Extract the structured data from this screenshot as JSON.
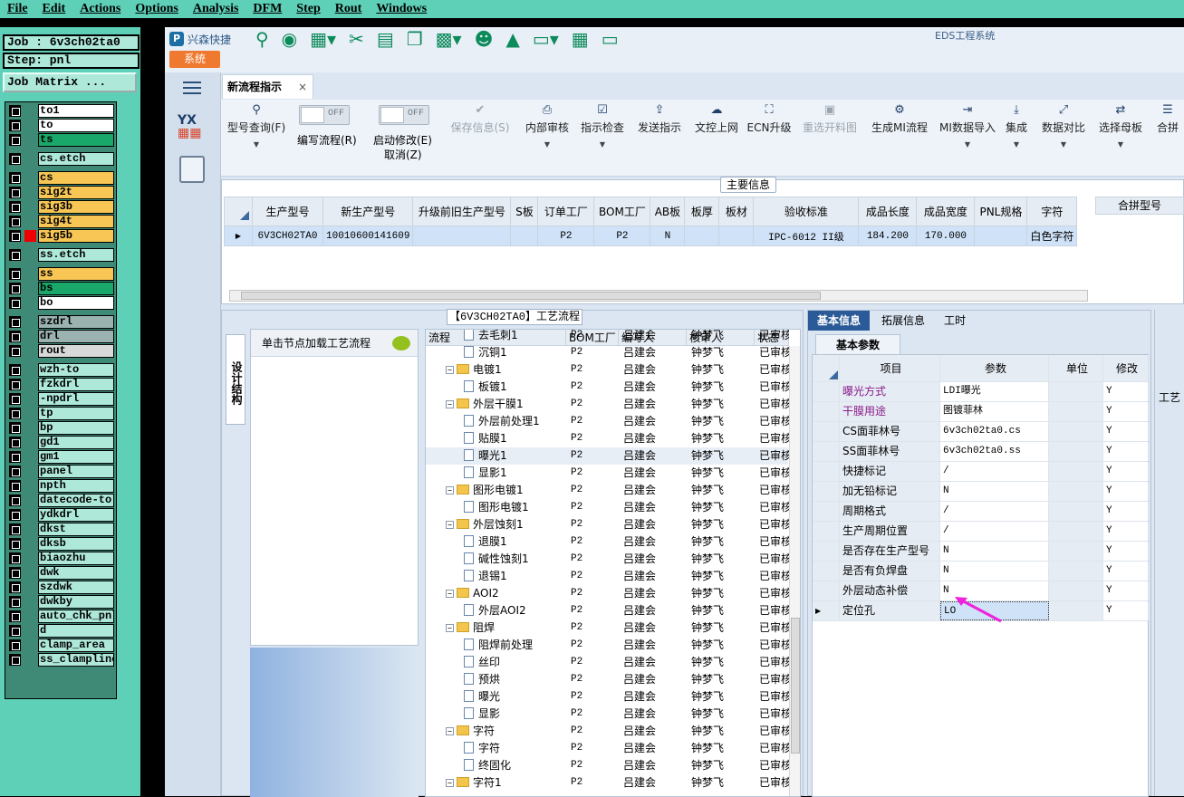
{
  "menu": [
    "File",
    "Edit",
    "Actions",
    "Options",
    "Analysis",
    "DFM",
    "Step",
    "Rout",
    "Windows"
  ],
  "job": {
    "job_label": "Job : 6v3ch02ta0",
    "step_label": "Step: pnl",
    "matrix_button": "Job Matrix ..."
  },
  "layers": [
    {
      "name": "to1",
      "bg": "#ffffff"
    },
    {
      "name": "to",
      "bg": "#ffffff"
    },
    {
      "name": "ts",
      "bg": "#1aa86a"
    },
    {
      "name": "cs.etch",
      "bg": "#aee8d9"
    },
    {
      "name": "cs",
      "bg": "#f7c655"
    },
    {
      "name": "sig2t",
      "bg": "#f7c655"
    },
    {
      "name": "sig3b",
      "bg": "#f7c655"
    },
    {
      "name": "sig4t",
      "bg": "#f7c655"
    },
    {
      "name": "sig5b",
      "bg": "#f7c655"
    },
    {
      "name": "ss.etch",
      "bg": "#aee8d9"
    },
    {
      "name": "ss",
      "bg": "#f7c655"
    },
    {
      "name": "bs",
      "bg": "#1aa86a"
    },
    {
      "name": "bo",
      "bg": "#ffffff"
    },
    {
      "name": "szdrl",
      "bg": "#9ab2b0"
    },
    {
      "name": "drl",
      "bg": "#9ab2b0"
    },
    {
      "name": "rout",
      "bg": "#d9d9d9"
    },
    {
      "name": "wzh-to",
      "bg": "#aee8d9"
    },
    {
      "name": "fzkdrl",
      "bg": "#aee8d9"
    },
    {
      "name": "-npdrl",
      "bg": "#aee8d9"
    },
    {
      "name": "tp",
      "bg": "#aee8d9"
    },
    {
      "name": "bp",
      "bg": "#aee8d9"
    },
    {
      "name": "gd1",
      "bg": "#aee8d9"
    },
    {
      "name": "gm1",
      "bg": "#aee8d9"
    },
    {
      "name": "panel",
      "bg": "#aee8d9"
    },
    {
      "name": "npth",
      "bg": "#aee8d9"
    },
    {
      "name": "datecode-to",
      "bg": "#aee8d9"
    },
    {
      "name": "ydkdrl",
      "bg": "#aee8d9"
    },
    {
      "name": "dkst",
      "bg": "#aee8d9"
    },
    {
      "name": "dksb",
      "bg": "#aee8d9"
    },
    {
      "name": "biaozhu",
      "bg": "#aee8d9"
    },
    {
      "name": "dwk",
      "bg": "#aee8d9"
    },
    {
      "name": "szdwk",
      "bg": "#aee8d9"
    },
    {
      "name": "dwkby",
      "bg": "#aee8d9"
    },
    {
      "name": "auto_chk_pnl",
      "bg": "#aee8d9"
    },
    {
      "name": "d",
      "bg": "#aee8d9"
    },
    {
      "name": "clamp_area",
      "bg": "#aee8d9"
    },
    {
      "name": "ss_clampline",
      "bg": "#aee8d9"
    }
  ],
  "app": {
    "brand": "兴森快捷",
    "title": "EDS工程系统",
    "sys_tab": "系统",
    "doc_tab": "新流程指示",
    "close": "×"
  },
  "ribbon": {
    "type_query": "型号查询(F)",
    "edit_flow": "编写流程(R)",
    "edit_flow_state": "OFF",
    "start_modify": "启动修改(E)",
    "start_modify_state": "OFF",
    "cancel": "取消(Z)",
    "buttons": [
      {
        "label": "保存信息(S)",
        "disabled": true,
        "icon": "check-icon"
      },
      {
        "label": "内部审核",
        "disabled": false,
        "icon": "printer-icon"
      },
      {
        "label": "指示检查",
        "disabled": false,
        "icon": "checkbox-icon"
      },
      {
        "label": "发送指示",
        "disabled": false,
        "icon": "upload-icon"
      },
      {
        "label": "文控上网",
        "disabled": false,
        "icon": "cloud-upload-icon"
      },
      {
        "label": "ECN升级",
        "disabled": false,
        "icon": "ecn-icon"
      },
      {
        "label": "重选开料图",
        "disabled": true,
        "icon": "image-icon"
      },
      {
        "label": "生成MI流程",
        "disabled": false,
        "icon": "gears-icon"
      },
      {
        "label": "MI数据导入",
        "disabled": false,
        "icon": "import-icon"
      },
      {
        "label": "集成",
        "disabled": false,
        "icon": "download-icon"
      },
      {
        "label": "数据对比",
        "disabled": false,
        "icon": "compare-icon"
      },
      {
        "label": "选择母板",
        "disabled": false,
        "icon": "shuffle-icon"
      },
      {
        "label": "合拼",
        "disabled": false,
        "icon": "list-icon"
      }
    ]
  },
  "main_info": {
    "title": "主要信息",
    "headers": [
      "生产型号",
      "新生产型号",
      "升级前旧生产型号",
      "S板",
      "订单工厂",
      "BOM工厂",
      "AB板",
      "板厚",
      "板材",
      "验收标准",
      "成品长度",
      "成品宽度",
      "PNL规格",
      "字符"
    ],
    "row": [
      "6V3CH02TA0",
      "10010600141609",
      "",
      "",
      "P2",
      "P2",
      "N",
      "",
      "",
      "IPC-6012 II级",
      "184.200",
      "170.000",
      "",
      "白色字符"
    ],
    "side_header": "合拼型号"
  },
  "flow": {
    "title": "【6V3CH02TA0】工艺流程",
    "side_tab": "设计结构",
    "node_hint": "单击节点加载工艺流程",
    "headers": [
      "流程",
      "BOM工厂",
      "编写人",
      "核审人",
      "状态"
    ],
    "rows": [
      {
        "name": "去毛刺1",
        "level": 2,
        "type": "doc",
        "bom": "P2",
        "writer": "吕建会",
        "reviewer": "钟梦飞",
        "status": "已审核"
      },
      {
        "name": "沉铜1",
        "level": 2,
        "type": "doc",
        "bom": "P2",
        "writer": "吕建会",
        "reviewer": "钟梦飞",
        "status": "已审核"
      },
      {
        "name": "电镀1",
        "level": 1,
        "type": "folder",
        "bom": "P2",
        "writer": "吕建会",
        "reviewer": "钟梦飞",
        "status": "已审核"
      },
      {
        "name": "板镀1",
        "level": 2,
        "type": "doc",
        "bom": "P2",
        "writer": "吕建会",
        "reviewer": "钟梦飞",
        "status": "已审核"
      },
      {
        "name": "外层干膜1",
        "level": 1,
        "type": "folder",
        "bom": "P2",
        "writer": "吕建会",
        "reviewer": "钟梦飞",
        "status": "已审核"
      },
      {
        "name": "外层前处理1",
        "level": 2,
        "type": "doc",
        "bom": "P2",
        "writer": "吕建会",
        "reviewer": "钟梦飞",
        "status": "已审核"
      },
      {
        "name": "贴膜1",
        "level": 2,
        "type": "doc",
        "bom": "P2",
        "writer": "吕建会",
        "reviewer": "钟梦飞",
        "status": "已审核"
      },
      {
        "name": "曝光1",
        "level": 2,
        "type": "doc",
        "bom": "P2",
        "writer": "吕建会",
        "reviewer": "钟梦飞",
        "status": "已审核",
        "selected": true
      },
      {
        "name": "显影1",
        "level": 2,
        "type": "doc",
        "bom": "P2",
        "writer": "吕建会",
        "reviewer": "钟梦飞",
        "status": "已审核"
      },
      {
        "name": "图形电镀1",
        "level": 1,
        "type": "folder",
        "bom": "P2",
        "writer": "吕建会",
        "reviewer": "钟梦飞",
        "status": "已审核"
      },
      {
        "name": "图形电镀1",
        "level": 2,
        "type": "doc",
        "bom": "P2",
        "writer": "吕建会",
        "reviewer": "钟梦飞",
        "status": "已审核"
      },
      {
        "name": "外层蚀刻1",
        "level": 1,
        "type": "folder",
        "bom": "P2",
        "writer": "吕建会",
        "reviewer": "钟梦飞",
        "status": "已审核"
      },
      {
        "name": "退膜1",
        "level": 2,
        "type": "doc",
        "bom": "P2",
        "writer": "吕建会",
        "reviewer": "钟梦飞",
        "status": "已审核"
      },
      {
        "name": "碱性蚀刻1",
        "level": 2,
        "type": "doc",
        "bom": "P2",
        "writer": "吕建会",
        "reviewer": "钟梦飞",
        "status": "已审核"
      },
      {
        "name": "退锡1",
        "level": 2,
        "type": "doc",
        "bom": "P2",
        "writer": "吕建会",
        "reviewer": "钟梦飞",
        "status": "已审核"
      },
      {
        "name": "AOI2",
        "level": 1,
        "type": "folder",
        "bom": "P2",
        "writer": "吕建会",
        "reviewer": "钟梦飞",
        "status": "已审核"
      },
      {
        "name": "外层AOI2",
        "level": 2,
        "type": "doc",
        "bom": "P2",
        "writer": "吕建会",
        "reviewer": "钟梦飞",
        "status": "已审核"
      },
      {
        "name": "阻焊",
        "level": 1,
        "type": "folder",
        "bom": "P2",
        "writer": "吕建会",
        "reviewer": "钟梦飞",
        "status": "已审核"
      },
      {
        "name": "阻焊前处理",
        "level": 2,
        "type": "doc",
        "bom": "P2",
        "writer": "吕建会",
        "reviewer": "钟梦飞",
        "status": "已审核"
      },
      {
        "name": "丝印",
        "level": 2,
        "type": "doc",
        "bom": "P2",
        "writer": "吕建会",
        "reviewer": "钟梦飞",
        "status": "已审核"
      },
      {
        "name": "预烘",
        "level": 2,
        "type": "doc",
        "bom": "P2",
        "writer": "吕建会",
        "reviewer": "钟梦飞",
        "status": "已审核"
      },
      {
        "name": "曝光",
        "level": 2,
        "type": "doc",
        "bom": "P2",
        "writer": "吕建会",
        "reviewer": "钟梦飞",
        "status": "已审核"
      },
      {
        "name": "显影",
        "level": 2,
        "type": "doc",
        "bom": "P2",
        "writer": "吕建会",
        "reviewer": "钟梦飞",
        "status": "已审核"
      },
      {
        "name": "字符",
        "level": 1,
        "type": "folder",
        "bom": "P2",
        "writer": "吕建会",
        "reviewer": "钟梦飞",
        "status": "已审核"
      },
      {
        "name": "字符",
        "level": 2,
        "type": "doc",
        "bom": "P2",
        "writer": "吕建会",
        "reviewer": "钟梦飞",
        "status": "已审核"
      },
      {
        "name": "终固化",
        "level": 2,
        "type": "doc",
        "bom": "P2",
        "writer": "吕建会",
        "reviewer": "钟梦飞",
        "status": "已审核"
      },
      {
        "name": "字符1",
        "level": 1,
        "type": "folder",
        "bom": "P2",
        "writer": "吕建会",
        "reviewer": "钟梦飞",
        "status": "已审核"
      }
    ]
  },
  "basic": {
    "tabs": [
      "基本信息",
      "拓展信息",
      "工时"
    ],
    "subtab": "基本参数",
    "headers": [
      "项目",
      "参数",
      "单位",
      "修改"
    ],
    "rows": [
      {
        "item": "曝光方式",
        "param": "LDI曝光",
        "unit": "",
        "mod": "Y",
        "highlight": true
      },
      {
        "item": "干膜用途",
        "param": "图镀菲林",
        "unit": "",
        "mod": "Y",
        "highlight": true
      },
      {
        "item": "CS面菲林号",
        "param": "6v3ch02ta0.cs",
        "unit": "",
        "mod": "Y",
        "highlight": false
      },
      {
        "item": "SS面菲林号",
        "param": "6v3ch02ta0.ss",
        "unit": "",
        "mod": "Y",
        "highlight": false
      },
      {
        "item": "快捷标记",
        "param": "/",
        "unit": "",
        "mod": "Y",
        "highlight": false
      },
      {
        "item": "加无铅标记",
        "param": "N",
        "unit": "",
        "mod": "Y",
        "highlight": false
      },
      {
        "item": "周期格式",
        "param": "/",
        "unit": "",
        "mod": "Y",
        "highlight": false
      },
      {
        "item": "生产周期位置",
        "param": "/",
        "unit": "",
        "mod": "Y",
        "highlight": false
      },
      {
        "item": "是否存在生产型号",
        "param": "N",
        "unit": "",
        "mod": "Y",
        "highlight": false
      },
      {
        "item": "是否有负焊盘",
        "param": "N",
        "unit": "",
        "mod": "Y",
        "highlight": false
      },
      {
        "item": "外层动态补偿",
        "param": "N",
        "unit": "",
        "mod": "Y",
        "highlight": false
      },
      {
        "item": "定位孔",
        "param": "LO",
        "unit": "",
        "mod": "Y",
        "highlight": false,
        "current": true
      }
    ],
    "far_right_tab": "工艺"
  }
}
